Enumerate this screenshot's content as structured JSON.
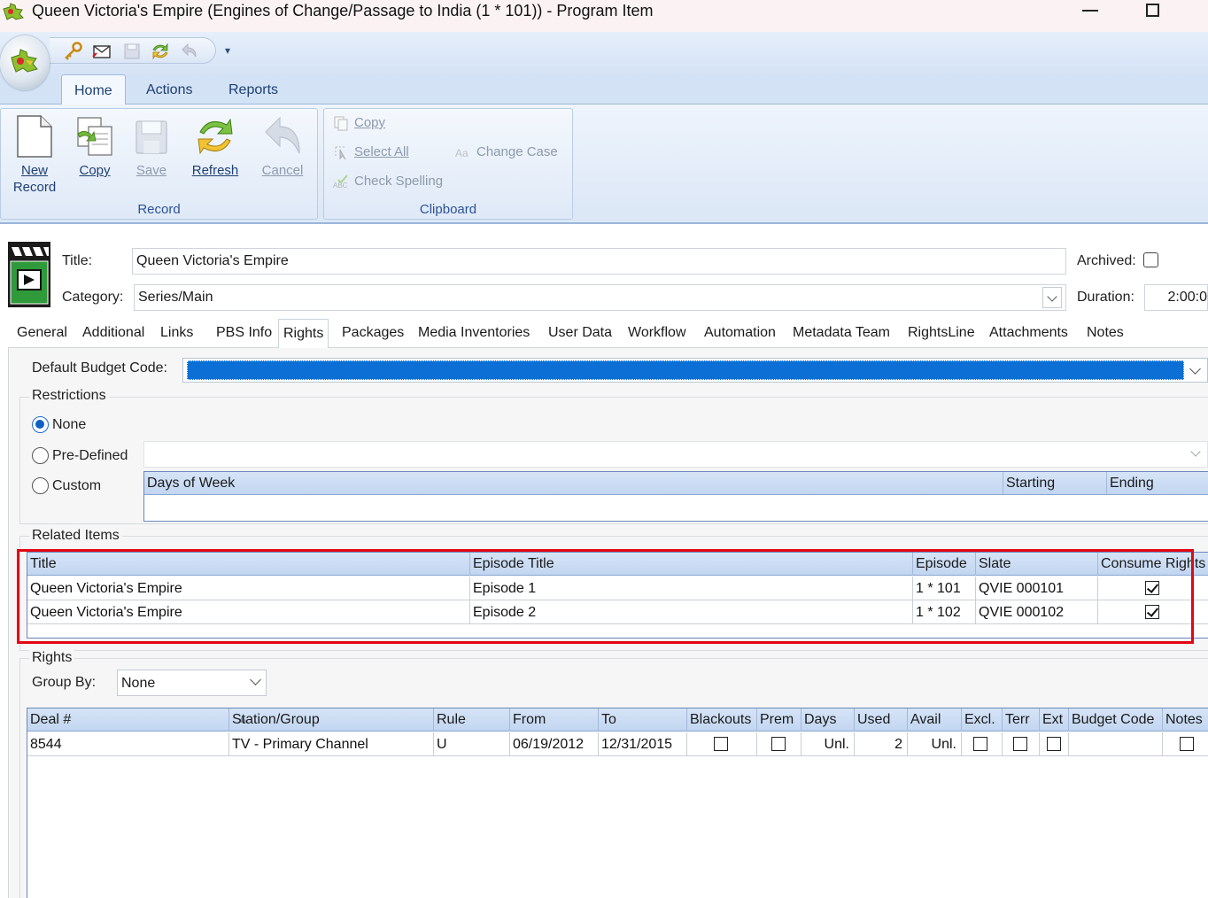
{
  "window": {
    "title": "Queen Victoria's Empire (Engines of Change/Passage to India (1 * 101)) - Program Item"
  },
  "ribbon": {
    "tabs": [
      "Home",
      "Actions",
      "Reports"
    ],
    "active_tab": "Home",
    "record_group": {
      "label": "Record",
      "buttons": {
        "new_line1": "New",
        "new_line2": "Record",
        "copy": "Copy",
        "save": "Save",
        "refresh": "Refresh",
        "cancel": "Cancel"
      }
    },
    "clipboard_group": {
      "label": "Clipboard",
      "buttons": {
        "copy": "Copy",
        "select_all": "Select All",
        "check_spelling": "Check Spelling",
        "change_case": "Change Case"
      }
    }
  },
  "form": {
    "title_label": "Title:",
    "title_value": "Queen Victoria's Empire",
    "category_label": "Category:",
    "category_value": "Series/Main",
    "archived_label": "Archived:",
    "duration_label": "Duration:",
    "duration_value": "2:00:0"
  },
  "form_tabs": [
    "General",
    "Additional",
    "Links",
    "PBS Info",
    "Rights",
    "Packages",
    "Media Inventories",
    "User Data",
    "Workflow",
    "Automation",
    "Metadata Team",
    "RightsLine",
    "Attachments",
    "Notes"
  ],
  "active_form_tab": "Rights",
  "rights_tab": {
    "default_budget_label": "Default Budget Code:",
    "restrictions": {
      "title": "Restrictions",
      "options": [
        "None",
        "Pre-Defined",
        "Custom"
      ],
      "selected": "None",
      "columns": [
        "Days of Week",
        "Starting",
        "Ending"
      ]
    },
    "related_items": {
      "title": "Related Items",
      "columns": [
        "Title",
        "Episode Title",
        "Episode",
        "Slate",
        "Consume Rights"
      ],
      "rows": [
        {
          "title": "Queen Victoria's Empire",
          "episode_title": "Episode 1",
          "episode": "1 * 101",
          "slate": "QVIE  000101",
          "consume_rights": true
        },
        {
          "title": "Queen Victoria's Empire",
          "episode_title": "Episode 2",
          "episode": "1 * 102",
          "slate": "QVIE  000102",
          "consume_rights": true
        }
      ]
    },
    "rights": {
      "title": "Rights",
      "group_by_label": "Group By:",
      "group_by_value": "None",
      "columns": [
        "Deal #",
        "Station/Group",
        "Rule",
        "From",
        "To",
        "Blackouts",
        "Prem",
        "Days",
        "Used",
        "Avail",
        "Excl.",
        "Terr",
        "Ext",
        "Budget Code",
        "Notes"
      ],
      "rows": [
        {
          "deal": "8544",
          "station": "TV - Primary Channel",
          "rule": "U",
          "from": "06/19/2012",
          "to": "12/31/2015",
          "blackouts": false,
          "prem": false,
          "days": "Unl.",
          "used": "2",
          "avail": "Unl.",
          "excl": false,
          "terr": false,
          "ext": false,
          "budget_code": "",
          "notes": false
        }
      ]
    }
  },
  "colors": {
    "highlight": "#e30613",
    "selection": "#0b6fd6",
    "ribbon_text": "#1e3f73"
  }
}
